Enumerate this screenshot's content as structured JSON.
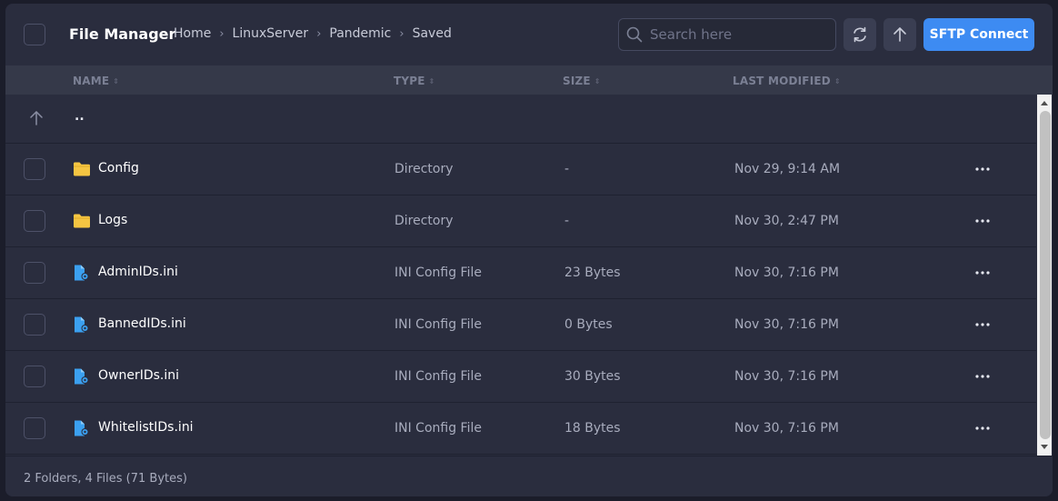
{
  "header": {
    "title": "File Manager",
    "breadcrumb": [
      "Home",
      "LinuxServer",
      "Pandemic",
      "Saved"
    ],
    "breadcrumb_separator": "›",
    "search_placeholder": "Search here",
    "sftp_label": "SFTP Connect"
  },
  "table": {
    "columns": {
      "name": "NAME",
      "type": "TYPE",
      "size": "SIZE",
      "modified": "LAST MODIFIED"
    },
    "parent_label": "..",
    "rows": [
      {
        "name": "Config",
        "type": "Directory",
        "size": "-",
        "modified": "Nov 29, 9:14 AM",
        "icon": "folder-icon"
      },
      {
        "name": "Logs",
        "type": "Directory",
        "size": "-",
        "modified": "Nov 30, 2:47 PM",
        "icon": "folder-icon"
      },
      {
        "name": "AdminIDs.ini",
        "type": "INI Config File",
        "size": "23 Bytes",
        "modified": "Nov 30, 7:16 PM",
        "icon": "config-file-icon"
      },
      {
        "name": "BannedIDs.ini",
        "type": "INI Config File",
        "size": "0 Bytes",
        "modified": "Nov 30, 7:16 PM",
        "icon": "config-file-icon"
      },
      {
        "name": "OwnerIDs.ini",
        "type": "INI Config File",
        "size": "30 Bytes",
        "modified": "Nov 30, 7:16 PM",
        "icon": "config-file-icon"
      },
      {
        "name": "WhitelistIDs.ini",
        "type": "INI Config File",
        "size": "18 Bytes",
        "modified": "Nov 30, 7:16 PM",
        "icon": "config-file-icon"
      }
    ]
  },
  "footer": {
    "summary": "2 Folders, 4 Files (71 Bytes)"
  },
  "colors": {
    "accent": "#3d8bf2",
    "folder": "#f5c542",
    "file": "#3ba0f0",
    "panel": "#2a2d3e"
  }
}
